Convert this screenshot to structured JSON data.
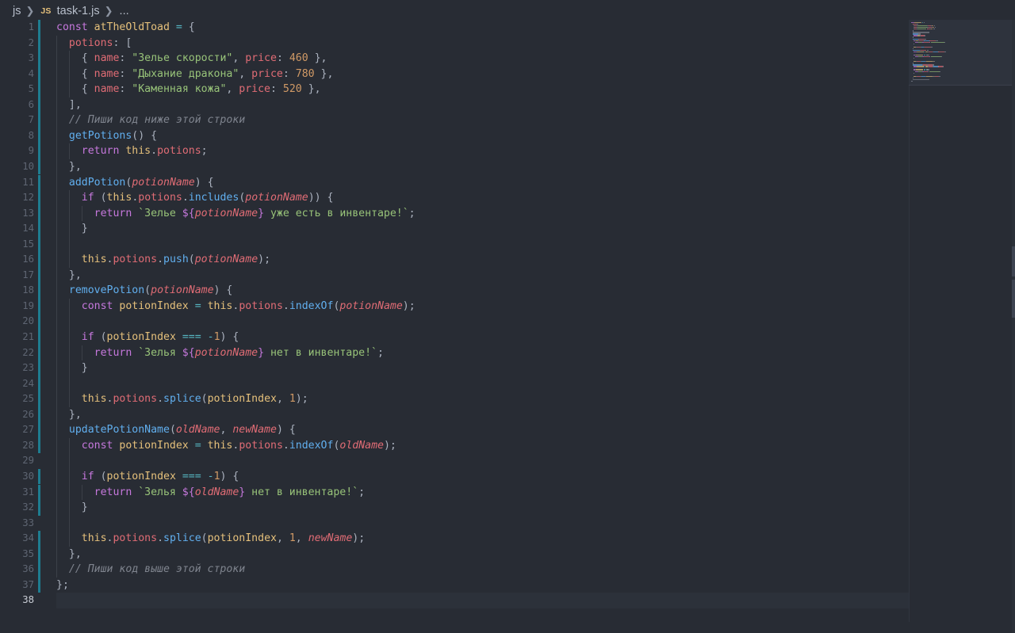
{
  "breadcrumb": {
    "folder": "js",
    "file_icon": "JS",
    "file": "task-1.js",
    "more": "..."
  },
  "editor": {
    "active_line": 38,
    "modified_lines": [
      1,
      2,
      3,
      4,
      5,
      6,
      7,
      8,
      9,
      10,
      11,
      12,
      13,
      14,
      15,
      16,
      17,
      18,
      19,
      20,
      21,
      22,
      23,
      24,
      25,
      26,
      27,
      28,
      30,
      31,
      32,
      34,
      35,
      36,
      37
    ],
    "lines": [
      [
        [
          "k",
          "const "
        ],
        [
          "v",
          "atTheOldToad"
        ],
        [
          "pl",
          " "
        ],
        [
          "o",
          "="
        ],
        [
          "pl",
          " {"
        ]
      ],
      [
        [
          "pl",
          "  "
        ],
        [
          "p",
          "potions"
        ],
        [
          "pl",
          ": ["
        ]
      ],
      [
        [
          "pl",
          "    { "
        ],
        [
          "p",
          "name"
        ],
        [
          "pl",
          ": "
        ],
        [
          "s",
          "\"Зелье скорости\""
        ],
        [
          "pl",
          ", "
        ],
        [
          "p",
          "price"
        ],
        [
          "pl",
          ": "
        ],
        [
          "n",
          "460"
        ],
        [
          "pl",
          " },"
        ]
      ],
      [
        [
          "pl",
          "    { "
        ],
        [
          "p",
          "name"
        ],
        [
          "pl",
          ": "
        ],
        [
          "s",
          "\"Дыхание дракона\""
        ],
        [
          "pl",
          ", "
        ],
        [
          "p",
          "price"
        ],
        [
          "pl",
          ": "
        ],
        [
          "n",
          "780"
        ],
        [
          "pl",
          " },"
        ]
      ],
      [
        [
          "pl",
          "    { "
        ],
        [
          "p",
          "name"
        ],
        [
          "pl",
          ": "
        ],
        [
          "s",
          "\"Каменная кожа\""
        ],
        [
          "pl",
          ", "
        ],
        [
          "p",
          "price"
        ],
        [
          "pl",
          ": "
        ],
        [
          "n",
          "520"
        ],
        [
          "pl",
          " },"
        ]
      ],
      [
        [
          "pl",
          "  ],"
        ]
      ],
      [
        [
          "c",
          "  // Пиши код ниже этой строки"
        ]
      ],
      [
        [
          "pl",
          "  "
        ],
        [
          "f",
          "getPotions"
        ],
        [
          "pl",
          "() {"
        ]
      ],
      [
        [
          "pl",
          "    "
        ],
        [
          "k",
          "return "
        ],
        [
          "t",
          "this"
        ],
        [
          "pl",
          "."
        ],
        [
          "p",
          "potions"
        ],
        [
          "pl",
          ";"
        ]
      ],
      [
        [
          "pl",
          "  },"
        ]
      ],
      [
        [
          "pl",
          "  "
        ],
        [
          "f",
          "addPotion"
        ],
        [
          "pl",
          "("
        ],
        [
          "prm",
          "potionName"
        ],
        [
          "pl",
          ") {"
        ]
      ],
      [
        [
          "pl",
          "    "
        ],
        [
          "k",
          "if"
        ],
        [
          "pl",
          " ("
        ],
        [
          "t",
          "this"
        ],
        [
          "pl",
          "."
        ],
        [
          "p",
          "potions"
        ],
        [
          "pl",
          "."
        ],
        [
          "f",
          "includes"
        ],
        [
          "pl",
          "("
        ],
        [
          "prm",
          "potionName"
        ],
        [
          "pl",
          ")) {"
        ]
      ],
      [
        [
          "pl",
          "      "
        ],
        [
          "k",
          "return "
        ],
        [
          "s",
          "`Зелье "
        ],
        [
          "k",
          "${"
        ],
        [
          "prm",
          "potionName"
        ],
        [
          "k",
          "}"
        ],
        [
          "s",
          " уже есть в инвентаре!`"
        ],
        [
          "pl",
          ";"
        ]
      ],
      [
        [
          "pl",
          "    }"
        ]
      ],
      [],
      [
        [
          "pl",
          "    "
        ],
        [
          "t",
          "this"
        ],
        [
          "pl",
          "."
        ],
        [
          "p",
          "potions"
        ],
        [
          "pl",
          "."
        ],
        [
          "f",
          "push"
        ],
        [
          "pl",
          "("
        ],
        [
          "prm",
          "potionName"
        ],
        [
          "pl",
          ");"
        ]
      ],
      [
        [
          "pl",
          "  },"
        ]
      ],
      [
        [
          "pl",
          "  "
        ],
        [
          "f",
          "removePotion"
        ],
        [
          "pl",
          "("
        ],
        [
          "prm",
          "potionName"
        ],
        [
          "pl",
          ") {"
        ]
      ],
      [
        [
          "pl",
          "    "
        ],
        [
          "k",
          "const "
        ],
        [
          "v",
          "potionIndex"
        ],
        [
          "pl",
          " "
        ],
        [
          "o",
          "="
        ],
        [
          "pl",
          " "
        ],
        [
          "t",
          "this"
        ],
        [
          "pl",
          "."
        ],
        [
          "p",
          "potions"
        ],
        [
          "pl",
          "."
        ],
        [
          "f",
          "indexOf"
        ],
        [
          "pl",
          "("
        ],
        [
          "prm",
          "potionName"
        ],
        [
          "pl",
          ");"
        ]
      ],
      [],
      [
        [
          "pl",
          "    "
        ],
        [
          "k",
          "if"
        ],
        [
          "pl",
          " ("
        ],
        [
          "v",
          "potionIndex"
        ],
        [
          "pl",
          " "
        ],
        [
          "o",
          "==="
        ],
        [
          "pl",
          " "
        ],
        [
          "o",
          "-"
        ],
        [
          "n",
          "1"
        ],
        [
          "pl",
          ") {"
        ]
      ],
      [
        [
          "pl",
          "      "
        ],
        [
          "k",
          "return "
        ],
        [
          "s",
          "`Зелья "
        ],
        [
          "k",
          "${"
        ],
        [
          "prm",
          "potionName"
        ],
        [
          "k",
          "}"
        ],
        [
          "s",
          " нет в инвентаре!`"
        ],
        [
          "pl",
          ";"
        ]
      ],
      [
        [
          "pl",
          "    }"
        ]
      ],
      [],
      [
        [
          "pl",
          "    "
        ],
        [
          "t",
          "this"
        ],
        [
          "pl",
          "."
        ],
        [
          "p",
          "potions"
        ],
        [
          "pl",
          "."
        ],
        [
          "f",
          "splice"
        ],
        [
          "pl",
          "("
        ],
        [
          "v",
          "potionIndex"
        ],
        [
          "pl",
          ", "
        ],
        [
          "n",
          "1"
        ],
        [
          "pl",
          ");"
        ]
      ],
      [
        [
          "pl",
          "  },"
        ]
      ],
      [
        [
          "pl",
          "  "
        ],
        [
          "f",
          "updatePotionName"
        ],
        [
          "pl",
          "("
        ],
        [
          "prm",
          "oldName"
        ],
        [
          "pl",
          ", "
        ],
        [
          "prm",
          "newName"
        ],
        [
          "pl",
          ") {"
        ]
      ],
      [
        [
          "pl",
          "    "
        ],
        [
          "k",
          "const "
        ],
        [
          "v",
          "potionIndex"
        ],
        [
          "pl",
          " "
        ],
        [
          "o",
          "="
        ],
        [
          "pl",
          " "
        ],
        [
          "t",
          "this"
        ],
        [
          "pl",
          "."
        ],
        [
          "p",
          "potions"
        ],
        [
          "pl",
          "."
        ],
        [
          "f",
          "indexOf"
        ],
        [
          "pl",
          "("
        ],
        [
          "prm",
          "oldName"
        ],
        [
          "pl",
          ");"
        ]
      ],
      [],
      [
        [
          "pl",
          "    "
        ],
        [
          "k",
          "if"
        ],
        [
          "pl",
          " ("
        ],
        [
          "v",
          "potionIndex"
        ],
        [
          "pl",
          " "
        ],
        [
          "o",
          "==="
        ],
        [
          "pl",
          " "
        ],
        [
          "o",
          "-"
        ],
        [
          "n",
          "1"
        ],
        [
          "pl",
          ") {"
        ]
      ],
      [
        [
          "pl",
          "      "
        ],
        [
          "k",
          "return "
        ],
        [
          "s",
          "`Зелья "
        ],
        [
          "k",
          "${"
        ],
        [
          "prm",
          "oldName"
        ],
        [
          "k",
          "}"
        ],
        [
          "s",
          " нет в инвентаре!`"
        ],
        [
          "pl",
          ";"
        ]
      ],
      [
        [
          "pl",
          "    }"
        ]
      ],
      [],
      [
        [
          "pl",
          "    "
        ],
        [
          "t",
          "this"
        ],
        [
          "pl",
          "."
        ],
        [
          "p",
          "potions"
        ],
        [
          "pl",
          "."
        ],
        [
          "f",
          "splice"
        ],
        [
          "pl",
          "("
        ],
        [
          "v",
          "potionIndex"
        ],
        [
          "pl",
          ", "
        ],
        [
          "n",
          "1"
        ],
        [
          "pl",
          ", "
        ],
        [
          "prm",
          "newName"
        ],
        [
          "pl",
          ");"
        ]
      ],
      [
        [
          "pl",
          "  },"
        ]
      ],
      [
        [
          "c",
          "  // Пиши код выше этой строки"
        ]
      ],
      [
        [
          "pl",
          "};"
        ]
      ],
      []
    ]
  }
}
